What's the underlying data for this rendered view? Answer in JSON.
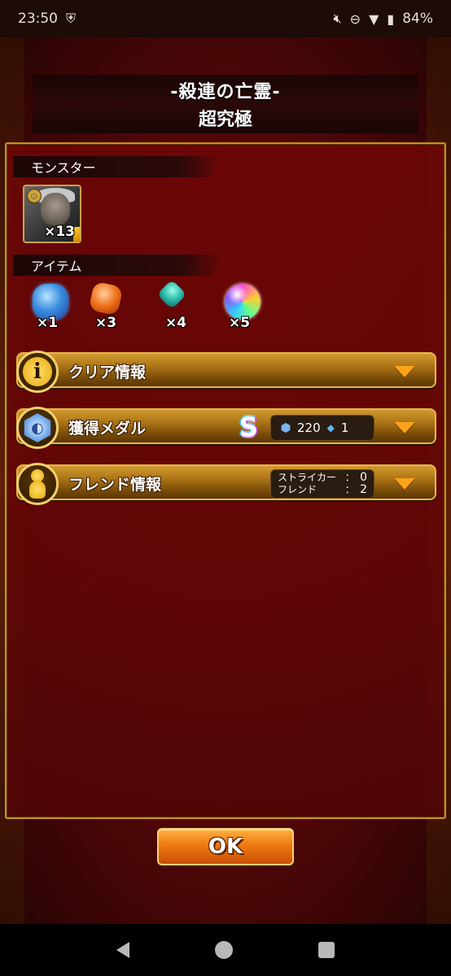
{
  "status_bar": {
    "time": "23:50",
    "battery": "84%",
    "icons": [
      "shield-icon",
      "mute-icon",
      "dnd-icon",
      "wifi-icon",
      "battery-icon"
    ]
  },
  "title": {
    "line1": "-殺連の亡霊-",
    "line2": "超究極"
  },
  "monster_section": {
    "header": "モンスター",
    "monster": {
      "icon": "old-man-monster-portrait",
      "count": "×13"
    }
  },
  "item_section": {
    "header": "アイテム",
    "items": [
      {
        "icon": "blue-crystal-icon",
        "qty": "×1"
      },
      {
        "icon": "orange-crystal-icon",
        "qty": "×3"
      },
      {
        "icon": "teal-crystal-icon",
        "qty": "×4"
      },
      {
        "icon": "rainbow-orb-icon",
        "qty": "×5"
      }
    ]
  },
  "bars": {
    "clear_info": {
      "label": "クリア情報"
    },
    "medal": {
      "label": "獲得メダル",
      "rank": "S",
      "medal_count": "220",
      "gem_count": "1"
    },
    "friend": {
      "label": "フレンド情報",
      "striker_label": "ストライカー",
      "striker_value": "0",
      "friend_label": "フレンド",
      "friend_value": "2",
      "separator": "："
    }
  },
  "ok_button": {
    "label": "OK"
  },
  "colors": {
    "panel_border": "#c9921a",
    "bar_gold": "#b07818",
    "arrow": "#ffa21a",
    "ok_orange": "#f07a12",
    "background_red": "#5c0808"
  }
}
